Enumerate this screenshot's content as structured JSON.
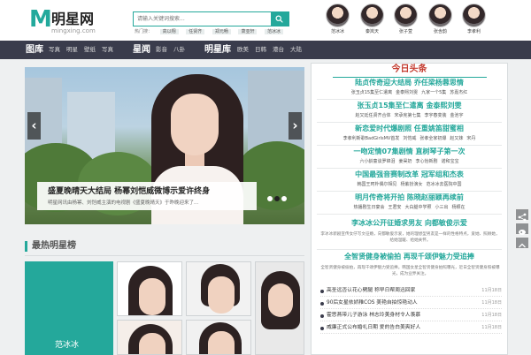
{
  "header": {
    "logo": {
      "mark": "M",
      "name": "明星网",
      "url": "mingxing.com"
    },
    "search": {
      "placeholder": "请输入关键词搜索..."
    },
    "hot_searches": [
      "热门搜：",
      "高以翔",
      "任贤齐",
      "郑元畅",
      "萧亚轩",
      "范冰冰"
    ],
    "avatars": [
      "范冰冰",
      "秦岚天",
      "张子萱",
      "张含韵",
      "李孝利"
    ]
  },
  "nav": {
    "groups": [
      {
        "label": "图库",
        "subs": [
          "写真",
          "明星",
          "壁纸",
          "写真"
        ]
      },
      {
        "label": "星闻",
        "subs": [
          "影音",
          "八卦"
        ]
      },
      {
        "label": "明星库",
        "subs": [
          "欧美",
          "日韩",
          "港台",
          "大陆"
        ]
      }
    ]
  },
  "slider": {
    "prev": "‹",
    "next": "›",
    "caption_title": "盛夏晚晴天大结局 杨幂刘恺威微博示爱许终身",
    "caption_desc": "明星网讯由杨幂、刘恺威主演的电视剧《盛夏晚晴天》于昨晚迎来了...",
    "dots": 3,
    "active_dot": 1
  },
  "hot_stars": {
    "title": "最热明星榜",
    "featured": "范冰冰"
  },
  "news": {
    "title": "今日头条",
    "headlines": [
      {
        "title": "陆贞传奇迎大结局 乔任梁杨蓉思情",
        "links": [
          "张玉贞15集至仁遣离",
          "金泰熙刘雯",
          "九家一个5集",
          "苏嘉杰红"
        ]
      },
      {
        "title": "张玉贞15集至仁遣离 金泰熙刘雯",
        "links": [
          "赵又廷任贤齐合体",
          "宋承宪第七集",
          "李宇春变装",
          "金池宇"
        ]
      },
      {
        "title": "新恋爱时代爆剧照 任重姚笛甜蜜相",
        "links": [
          "李孝利新歌BadGirlsMV首发",
          "刘恺威",
          "张孝全家初爆",
          "赵又妹",
          "宋丹"
        ]
      },
      {
        "title": "一吻定情07集剧情 直树琴子第一次",
        "links": [
          "六小龄童谈罗锦泪",
          "姜昊奶",
          "李心怡新剧",
          "诺和宝宝"
        ]
      },
      {
        "title": "中国最强音赛制改革 冠军组和杰表",
        "links": [
          "韩国王珂朴偶尔相见",
          "杨紫扮演女",
          "范冰冰去医院中国"
        ]
      },
      {
        "title": "明月传奇将开拍 陈晓赵丽颖再续前",
        "links": [
          "热播剧生日宴会",
          "王君安",
          "大白腿中学照",
          "小三出",
          "杨颖在"
        ]
      },
      {
        "title": "李冰冰公开征婚求男友 向都敏俊示爱",
        "links": []
      },
      {
        "title": "全智贤健身被偷拍 再现千颂伊魅力受追捧",
        "links": []
      }
    ],
    "excerpts": [
      "李冰冰新剧宣传女仔写文征婚，向都敏俊示爱，她的理想型男友是一样的性格特点，爱她、照顾她，给她温暖、给她关怀。",
      "全智贤健身被偷拍，再现千颂伊魅力受追捧。韩国女星全智贤健身拍照曝光，近日全智贤健身照被曝光，成为业界关注。"
    ],
    "list": [
      {
        "text": "高圣远否认花心劈腿 称早日帮周迅回家",
        "date": "11月18日"
      },
      {
        "text": "90后女星依娇稚COS 美艳自拍惊艳动人",
        "date": "11月18日"
      },
      {
        "text": "霍思燕带儿子游泳 林志玲美身材令人羡慕",
        "date": "11月18日"
      },
      {
        "text": "威廉正式公布婚礼日期 爱的告白美爽好人",
        "date": "11月18日"
      }
    ]
  },
  "float_icons": [
    "share-icon",
    "weibo-icon",
    "back-to-top-icon"
  ]
}
